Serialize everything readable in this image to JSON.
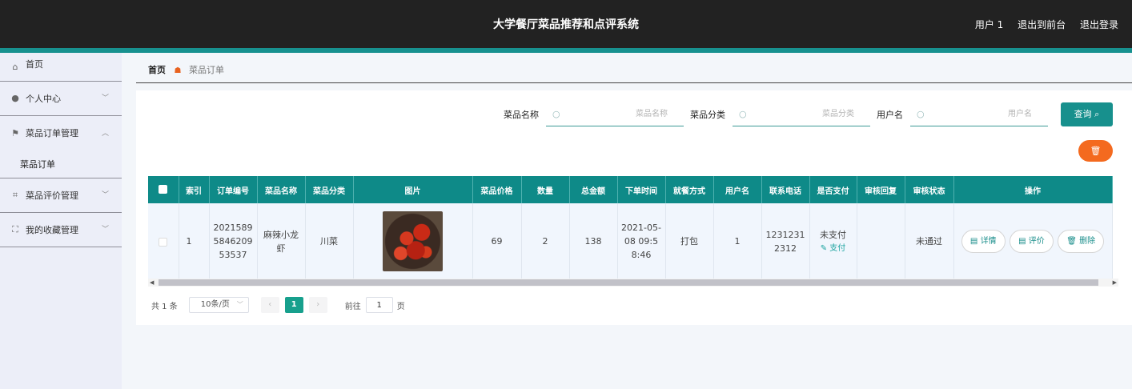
{
  "header": {
    "title": "大学餐厅菜品推荐和点评系统",
    "user": "用户 1",
    "to_front": "退出到前台",
    "logout": "退出登录"
  },
  "sidebar": {
    "items": [
      {
        "label": "首页",
        "icon": "home-icon"
      },
      {
        "label": "个人中心",
        "icon": "user-icon"
      },
      {
        "label": "菜品订单管理",
        "icon": "flag-icon"
      },
      {
        "label": "菜品评价管理",
        "icon": "crop-icon"
      },
      {
        "label": "我的收藏管理",
        "icon": "frame-icon"
      }
    ],
    "submenu": {
      "label": "菜品订单"
    }
  },
  "breadcrumb": {
    "home": "首页",
    "current": "菜品订单"
  },
  "search": {
    "dish_name_label": "菜品名称",
    "dish_name_placeholder": "菜品名称",
    "dish_category_label": "菜品分类",
    "dish_category_placeholder": "菜品分类",
    "username_label": "用户名",
    "username_placeholder": "用户名",
    "query_label": "查询"
  },
  "table": {
    "columns": [
      "索引",
      "订单编号",
      "菜品名称",
      "菜品分类",
      "图片",
      "菜品价格",
      "数量",
      "总金额",
      "下单时间",
      "就餐方式",
      "用户名",
      "联系电话",
      "是否支付",
      "审核回复",
      "审核状态",
      "操作"
    ],
    "rows": [
      {
        "index": "1",
        "order_no": "2021589584620953537",
        "dish_name": "麻辣小龙虾",
        "category": "川菜",
        "price": "69",
        "qty": "2",
        "total": "138",
        "order_time": "2021-05-08 09:58:46",
        "dining": "打包",
        "username": "1",
        "phone": "12312312312",
        "paid": "未支付",
        "pay_action": "支付",
        "review_reply": "",
        "review_status": "未通过",
        "actions": {
          "detail": "详情",
          "review": "评价",
          "delete": "删除"
        }
      }
    ]
  },
  "pager": {
    "total": "共 1 条",
    "page_size": "10条/页",
    "current_page": "1",
    "goto_label": "前往",
    "goto_value": "1",
    "page_unit": "页"
  },
  "colors": {
    "header": "#222222",
    "accent": "#17918f",
    "primary": "#0e8a88",
    "danger": "#f46a1f"
  }
}
